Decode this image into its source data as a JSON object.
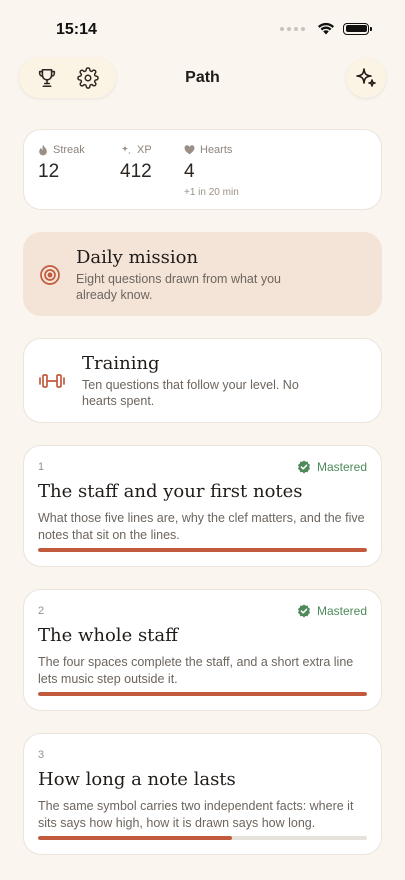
{
  "status_bar": {
    "time": "15:14"
  },
  "header": {
    "title": "Path",
    "left_icons": [
      "trophy-icon",
      "gear-icon"
    ],
    "right_icon": "sparkle-icon"
  },
  "stats": [
    {
      "label": "Streak",
      "value": "12",
      "icon": "flame-icon"
    },
    {
      "label": "XP",
      "value": "412",
      "icon": "sparkle-small-icon"
    },
    {
      "label": "Hearts",
      "value": "4",
      "icon": "heart-icon",
      "note": "+1 in 20 min"
    }
  ],
  "daily_mission": {
    "title": "Daily mission",
    "description": "Eight questions drawn from what you already know.",
    "icon": "target-icon"
  },
  "training": {
    "title": "Training",
    "description": "Ten questions that follow your level. No hearts spent.",
    "icon": "dumbbell-icon"
  },
  "lessons": [
    {
      "number": "1",
      "title": "The staff and your first notes",
      "description": "What those five lines are, why the clef matters, and the five notes that sit on the lines.",
      "status": "Mastered",
      "progress": 1.0
    },
    {
      "number": "2",
      "title": "The whole staff",
      "description": "The four spaces complete the staff, and a short extra line lets music step outside it.",
      "status": "Mastered",
      "progress": 1.0
    },
    {
      "number": "3",
      "title": "How long a note lasts",
      "description": "The same symbol carries two independent facts: where it sits says how high, how it is drawn says how long.",
      "status": "",
      "progress": 0.59
    }
  ],
  "colors": {
    "background": "#FAF5EE",
    "accent": "#C25B3E",
    "mastered": "#4E8A5A",
    "mission_bg": "#F4E4D7"
  }
}
